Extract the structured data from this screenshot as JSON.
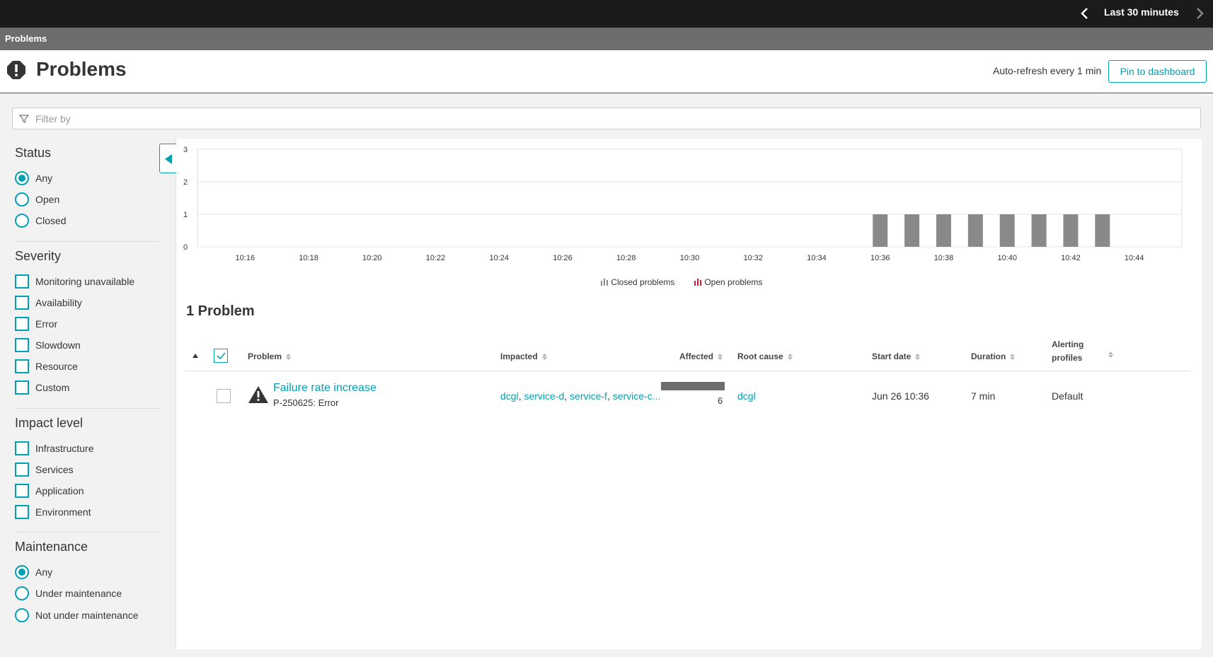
{
  "topbar": {
    "timeframe_label": "Last 30 minutes"
  },
  "breadcrumb": {
    "label": "Problems"
  },
  "header": {
    "title": "Problems",
    "autorefresh": "Auto-refresh every 1 min",
    "pin_button": "Pin to dashboard"
  },
  "filter": {
    "placeholder": "Filter by"
  },
  "sidebar": {
    "status": {
      "title": "Status",
      "options": [
        {
          "label": "Any",
          "selected": true
        },
        {
          "label": "Open",
          "selected": false
        },
        {
          "label": "Closed",
          "selected": false
        }
      ]
    },
    "severity": {
      "title": "Severity",
      "options": [
        {
          "label": "Monitoring unavailable",
          "checked": false
        },
        {
          "label": "Availability",
          "checked": false
        },
        {
          "label": "Error",
          "checked": false
        },
        {
          "label": "Slowdown",
          "checked": false
        },
        {
          "label": "Resource",
          "checked": false
        },
        {
          "label": "Custom",
          "checked": false
        }
      ]
    },
    "impact": {
      "title": "Impact level",
      "options": [
        {
          "label": "Infrastructure",
          "checked": false
        },
        {
          "label": "Services",
          "checked": false
        },
        {
          "label": "Application",
          "checked": false
        },
        {
          "label": "Environment",
          "checked": false
        }
      ]
    },
    "maintenance": {
      "title": "Maintenance",
      "options": [
        {
          "label": "Any",
          "selected": true
        },
        {
          "label": "Under maintenance",
          "selected": false
        },
        {
          "label": "Not under maintenance",
          "selected": false
        }
      ]
    }
  },
  "chart_data": {
    "type": "bar",
    "y_ticks": [
      "0",
      "1",
      "2",
      "3"
    ],
    "ylim": [
      0,
      3
    ],
    "x_ticks": [
      "10:16",
      "10:18",
      "10:20",
      "10:22",
      "10:24",
      "10:26",
      "10:28",
      "10:30",
      "10:32",
      "10:34",
      "10:36",
      "10:38",
      "10:40",
      "10:42",
      "10:44"
    ],
    "xlim": [
      "10:14:30",
      "10:45:30"
    ],
    "grid": true,
    "series": [
      {
        "name": "Closed problems",
        "color": "#898989",
        "points": [
          {
            "x": "10:36",
            "y": 1
          },
          {
            "x": "10:37",
            "y": 1
          },
          {
            "x": "10:38",
            "y": 1
          },
          {
            "x": "10:39",
            "y": 1
          },
          {
            "x": "10:40",
            "y": 1
          },
          {
            "x": "10:41",
            "y": 1
          },
          {
            "x": "10:42",
            "y": 1
          },
          {
            "x": "10:43",
            "y": 1
          }
        ]
      },
      {
        "name": "Open problems",
        "color": "#dc172a",
        "points": []
      }
    ],
    "legend_position": "bottom-center"
  },
  "problems": {
    "count_title": "1 Problem",
    "columns": {
      "problem": "Problem",
      "impacted": "Impacted",
      "affected": "Affected",
      "root_cause": "Root cause",
      "start_date": "Start date",
      "duration": "Duration",
      "alerting_1": "Alerting",
      "alerting_2": "profiles"
    },
    "rows": [
      {
        "title": "Failure rate increase",
        "subtitle": "P-250625: Error",
        "impacted": [
          "dcgl",
          "service-d",
          "service-f",
          "service-c..."
        ],
        "affected_count": "6",
        "root_cause": "dcgl",
        "start_date": "Jun 26 10:36",
        "duration": "7 min",
        "alerting_profile": "Default"
      }
    ]
  }
}
